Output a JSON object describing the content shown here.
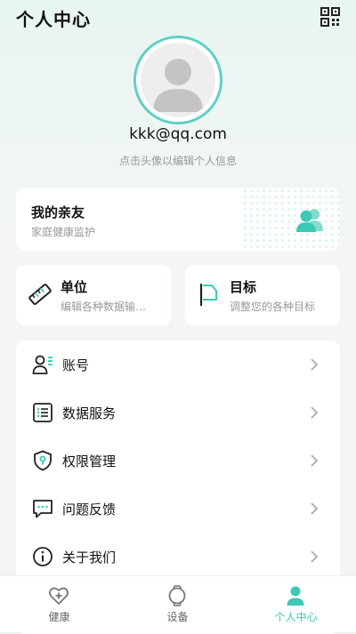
{
  "header": {
    "title": "个人中心"
  },
  "profile": {
    "email": "kkk@qq.com",
    "hint": "点击头像以编辑个人信息"
  },
  "family_card": {
    "title": "我的亲友",
    "subtitle": "家庭健康监护"
  },
  "unit_card": {
    "title": "单位",
    "subtitle": "编辑各种数据输…"
  },
  "goal_card": {
    "title": "目标",
    "subtitle": "调整您的各种目标"
  },
  "menu": {
    "items": [
      {
        "label": "账号",
        "icon": "account-icon"
      },
      {
        "label": "数据服务",
        "icon": "data-service-icon"
      },
      {
        "label": "权限管理",
        "icon": "shield-icon"
      },
      {
        "label": "问题反馈",
        "icon": "feedback-icon"
      },
      {
        "label": "关于我们",
        "icon": "info-icon"
      }
    ]
  },
  "tabbar": {
    "tabs": [
      {
        "label": "健康",
        "icon": "heart-plus-icon",
        "active": false
      },
      {
        "label": "设备",
        "icon": "watch-icon",
        "active": false
      },
      {
        "label": "个人中心",
        "icon": "person-icon",
        "active": true
      }
    ]
  },
  "colors": {
    "accent": "#3cc9b6",
    "avatar_ring": "#5fd1c3",
    "text_primary": "#111111",
    "text_secondary": "#999999"
  }
}
